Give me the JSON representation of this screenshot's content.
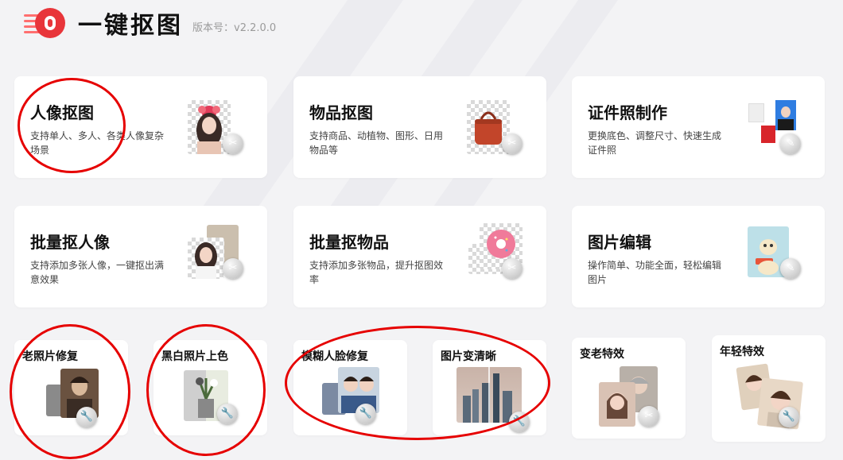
{
  "app": {
    "title": "一键抠图",
    "version": "版本号：v2.2.0.0"
  },
  "cards": [
    {
      "title": "人像抠图",
      "desc": "支持单人、多人、各类人像复杂场景"
    },
    {
      "title": "物品抠图",
      "desc": "支持商品、动植物、图形、日用物品等"
    },
    {
      "title": "证件照制作",
      "desc": "更换底色、调整尺寸、快速生成证件照"
    },
    {
      "title": "批量抠人像",
      "desc": "支持添加多张人像，一键抠出满意效果"
    },
    {
      "title": "批量抠物品",
      "desc": "支持添加多张物品，提升抠图效率"
    },
    {
      "title": "图片编辑",
      "desc": "操作简单、功能全面，轻松编辑图片"
    }
  ],
  "small_cards": [
    {
      "title": "老照片修复"
    },
    {
      "title": "黑白照片上色"
    },
    {
      "title": "模糊人脸修复"
    },
    {
      "title": "图片变清晰"
    },
    {
      "title": "变老特效"
    },
    {
      "title": "年轻特效"
    }
  ],
  "colors": {
    "accent": "#e8353a",
    "annotation": "#e60000",
    "background": "#f3f3f5"
  },
  "icons": [
    "scissors-icon",
    "wrench-icon",
    "pencil-icon"
  ]
}
